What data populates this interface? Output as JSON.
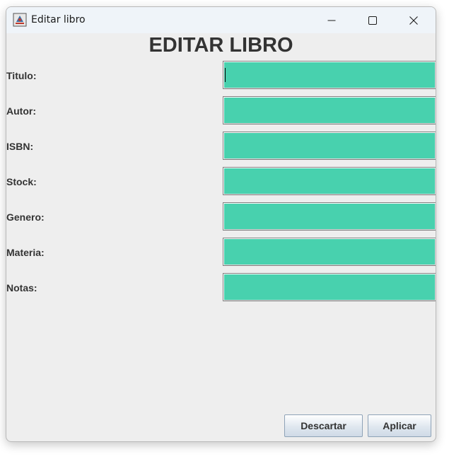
{
  "window": {
    "title": "Editar libro",
    "controls": {
      "minimize": "minimize-icon",
      "maximize": "maximize-icon",
      "close": "close-icon"
    }
  },
  "form": {
    "heading": "EDITAR LIBRO",
    "fields": [
      {
        "label": "Titulo:",
        "value": ""
      },
      {
        "label": "Autor:",
        "value": ""
      },
      {
        "label": "ISBN:",
        "value": ""
      },
      {
        "label": "Stock:",
        "value": ""
      },
      {
        "label": "Genero:",
        "value": ""
      },
      {
        "label": "Materia:",
        "value": ""
      },
      {
        "label": "Notas:",
        "value": ""
      }
    ]
  },
  "buttons": {
    "discard": "Descartar",
    "apply": "Aplicar"
  },
  "colors": {
    "field_background": "#48d1ae",
    "window_background": "#eeeeee",
    "titlebar_background": "#eff4f9"
  }
}
